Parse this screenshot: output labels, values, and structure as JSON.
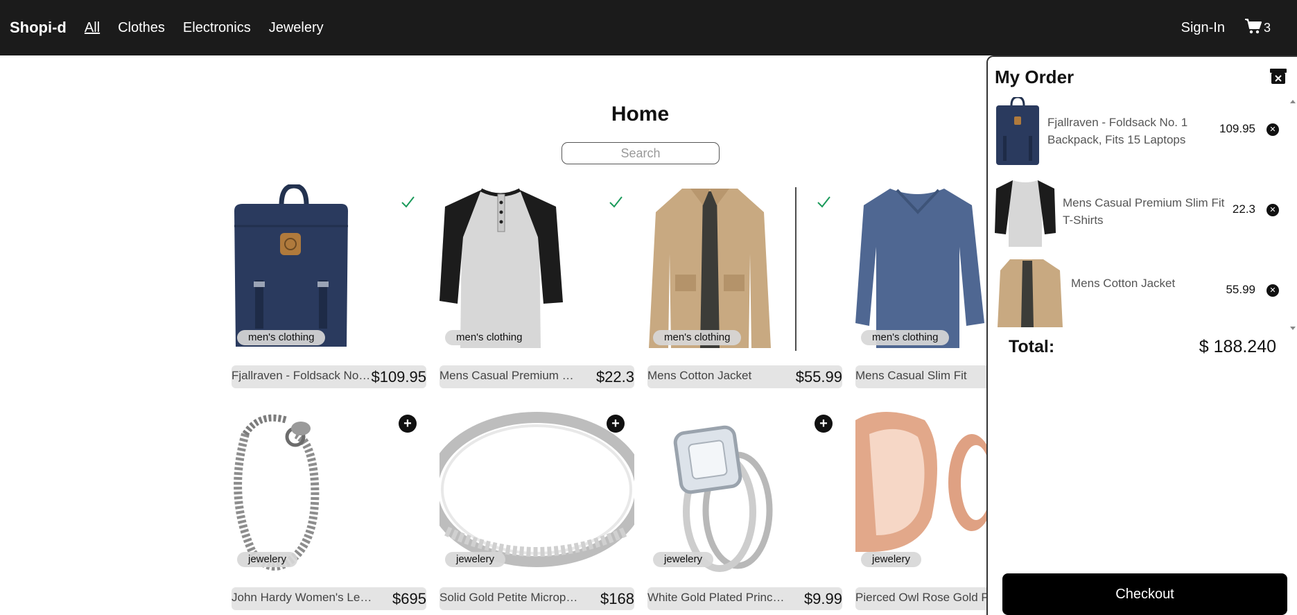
{
  "nav": {
    "brand": "Shopi-d",
    "links": [
      "All",
      "Clothes",
      "Electronics",
      "Jewelery"
    ],
    "active_link": "All",
    "signin": "Sign-In",
    "cart_count": "3",
    "bar_color": "#1b1b1b"
  },
  "main": {
    "title": "Home",
    "search_placeholder": "Search",
    "products": [
      {
        "category": "men's clothing",
        "title": "Fjallraven - Foldsack No. 1...",
        "price": "$109.95",
        "status": "added",
        "status_icon": "check-icon"
      },
      {
        "category": "men's clothing",
        "title": "Mens Casual Premium Slim F...",
        "price": "$22.3",
        "status": "added",
        "status_icon": "check-icon"
      },
      {
        "category": "men's clothing",
        "title": "Mens Cotton Jacket",
        "price": "$55.99",
        "status": "added",
        "status_icon": "check-icon"
      },
      {
        "category": "men's clothing",
        "title": "Mens Casual Slim Fit",
        "price": "",
        "status": "",
        "status_icon": ""
      },
      {
        "category": "jewelery",
        "title": "John Hardy Women's Legend...",
        "price": "$695",
        "status": "add",
        "status_icon": "plus-icon"
      },
      {
        "category": "jewelery",
        "title": "Solid Gold Petite Micropave",
        "price": "$168",
        "status": "add",
        "status_icon": "plus-icon"
      },
      {
        "category": "jewelery",
        "title": "White Gold Plated Princess",
        "price": "$9.99",
        "status": "add",
        "status_icon": "plus-icon"
      },
      {
        "category": "jewelery",
        "title": "Pierced Owl Rose Gold Pla",
        "price": "",
        "status": "",
        "status_icon": ""
      }
    ],
    "check_color": "#1a9a5a"
  },
  "order": {
    "title": "My Order",
    "items": [
      {
        "name": "Fjallraven - Foldsack No. 1 Backpack, Fits 15 Laptops",
        "price": "109.95",
        "remove_icon": "x-icon"
      },
      {
        "name": "Mens Casual Premium Slim Fit T-Shirts",
        "price": "22.3",
        "remove_icon": "x-icon"
      },
      {
        "name": "Mens Cotton Jacket",
        "price": "55.99",
        "remove_icon": "x-icon"
      }
    ],
    "total_label": "Total:",
    "total_value": "$ 188.240",
    "checkout_label": "Checkout",
    "close_icon": "close-archive-icon"
  }
}
